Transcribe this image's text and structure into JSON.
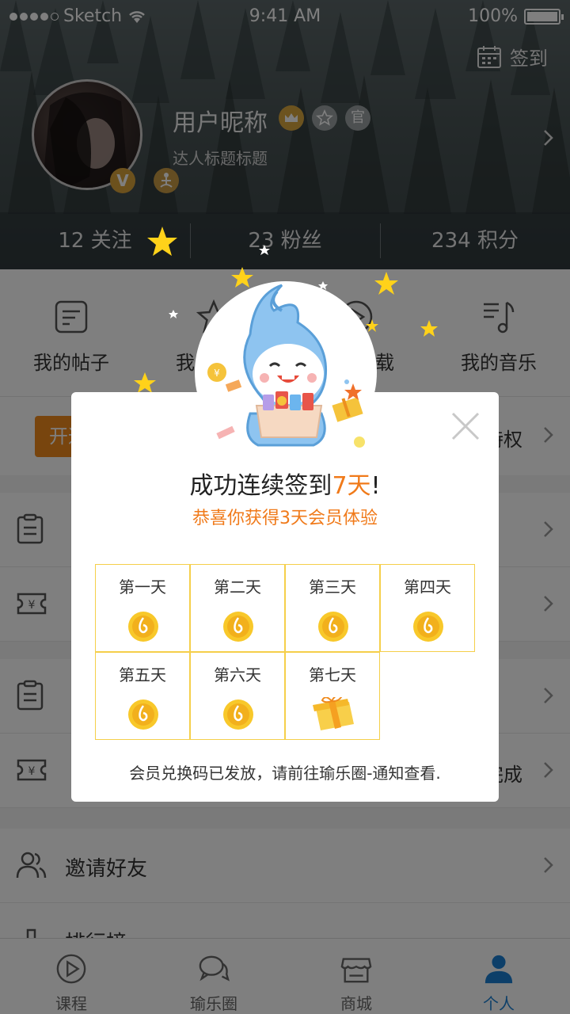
{
  "status_bar": {
    "carrier": "Sketch",
    "time": "9:41 AM",
    "battery": "100%"
  },
  "header": {
    "checkin_label": "签到",
    "username": "用户昵称",
    "badge_official": "官",
    "subtitle": "达人标题标题",
    "v_badge": "V",
    "stats": [
      {
        "label": "12 关注"
      },
      {
        "label": "23 粉丝"
      },
      {
        "label": "234 积分"
      }
    ]
  },
  "quick_actions": [
    {
      "label": "我的帖子",
      "icon": "post-icon"
    },
    {
      "label": "我的收藏",
      "icon": "star-icon"
    },
    {
      "label": "我的下载",
      "icon": "play-icon"
    },
    {
      "label": "我的音乐",
      "icon": "music-icon"
    }
  ],
  "vip": {
    "button_label": "开通",
    "right_text": "特权"
  },
  "list_right_text": "完成",
  "invite_label": "邀请好友",
  "ranking_label": "排行榜",
  "tabs": [
    {
      "label": "课程",
      "icon": "play-circle-icon"
    },
    {
      "label": "瑜乐圈",
      "icon": "chat-icon"
    },
    {
      "label": "商城",
      "icon": "store-icon"
    },
    {
      "label": "个人",
      "icon": "person-icon"
    }
  ],
  "dialog": {
    "title_prefix": "成功连续签到",
    "title_highlight": "7天",
    "title_suffix": "!",
    "subtitle": "恭喜你获得3天会员体验",
    "days": [
      {
        "label": "第一天",
        "reward": "coin"
      },
      {
        "label": "第二天",
        "reward": "coin"
      },
      {
        "label": "第三天",
        "reward": "coin"
      },
      {
        "label": "第四天",
        "reward": "coin"
      },
      {
        "label": "第五天",
        "reward": "coin"
      },
      {
        "label": "第六天",
        "reward": "coin"
      },
      {
        "label": "第七天",
        "reward": "gift"
      }
    ],
    "footer": "会员兑换码已发放，请前往瑜乐圈-通知查看."
  },
  "colors": {
    "accent_orange": "#f07a1a",
    "grid_border": "#f5cf4a",
    "tab_active": "#1a7fd2",
    "vip_orange": "#f08a1c"
  }
}
